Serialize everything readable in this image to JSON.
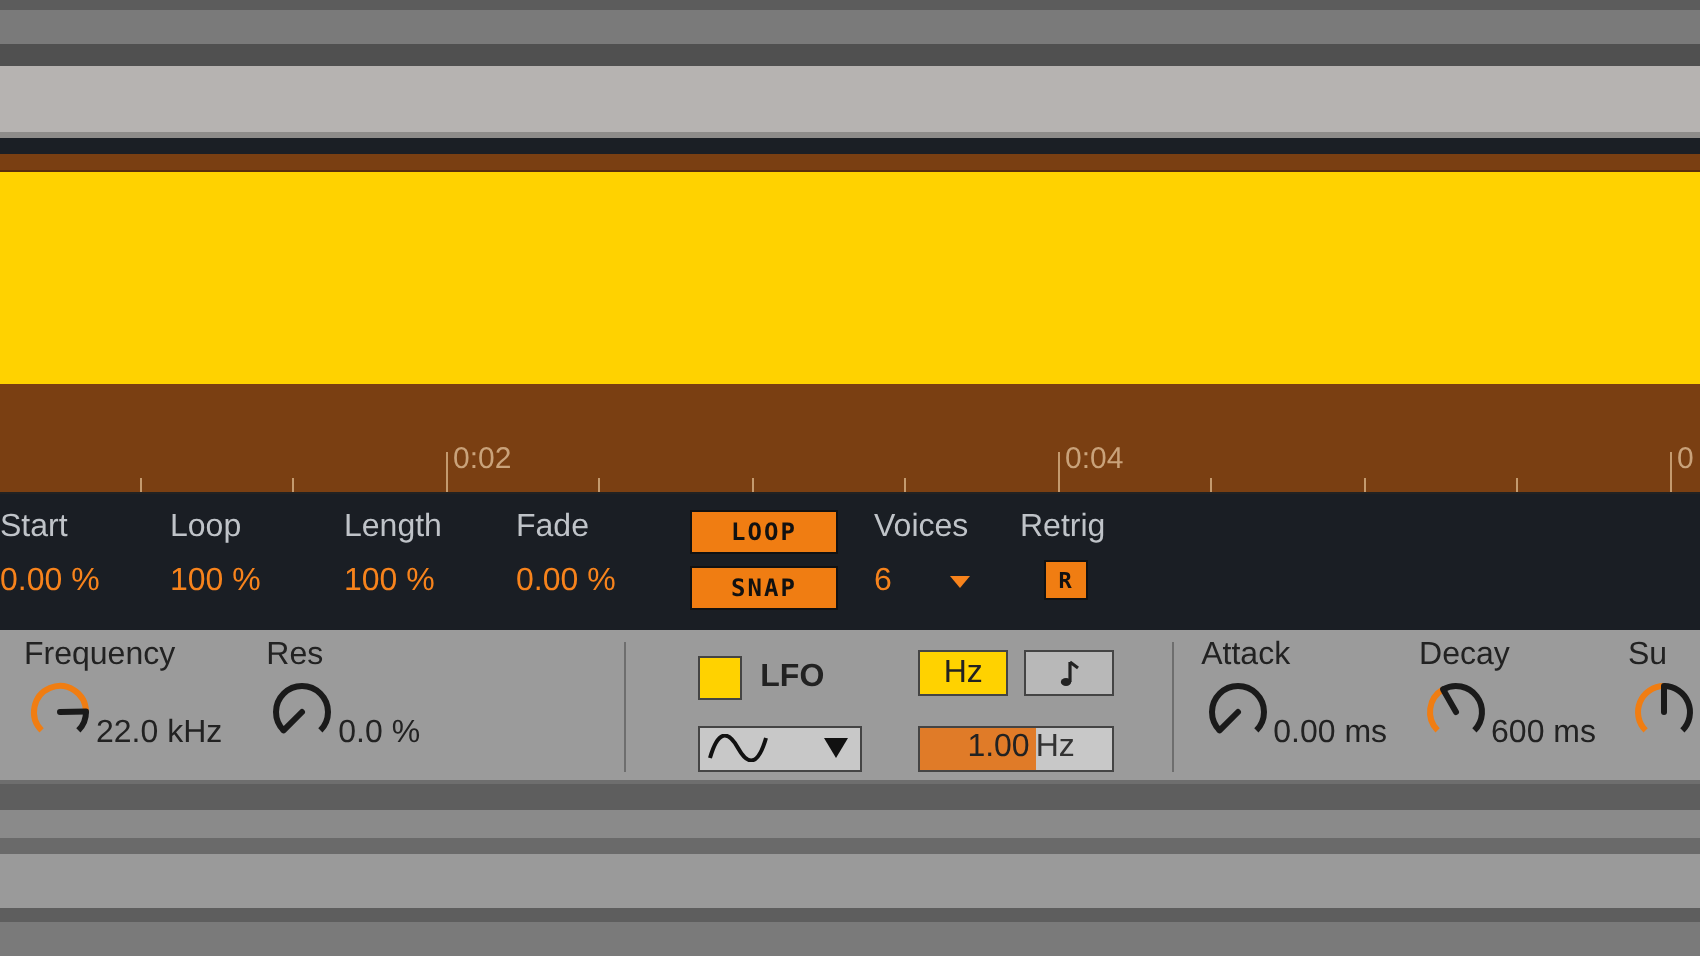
{
  "ruler": {
    "labels": [
      "0:02",
      "0:04",
      "0"
    ]
  },
  "sample": {
    "params": [
      {
        "label": "Start",
        "value": "0.00 %"
      },
      {
        "label": "Loop",
        "value": "100 %"
      },
      {
        "label": "Length",
        "value": "100 %"
      },
      {
        "label": "Fade",
        "value": "0.00 %"
      }
    ],
    "loop": {
      "label": "LOOP",
      "on": true
    },
    "snap": {
      "label": "SNAP",
      "on": true
    },
    "voices": {
      "label": "Voices",
      "value": "6"
    },
    "retrig": {
      "label": "Retrig",
      "button": "R",
      "on": true
    }
  },
  "filter": {
    "knobs": [
      {
        "label": "Frequency",
        "value": "22.0 kHz"
      },
      {
        "label": "Res",
        "value": "0.0 %"
      }
    ]
  },
  "lfo": {
    "label": "LFO",
    "checked": true,
    "rate_modes": [
      {
        "kind": "hz",
        "label": "Hz",
        "selected": true
      },
      {
        "kind": "note",
        "selected": false
      }
    ],
    "rate": {
      "value": "1.00",
      "unit": "Hz",
      "level": 0.6
    }
  },
  "envelope": {
    "knobs": [
      {
        "label": "Attack",
        "value": "0.00 ms"
      },
      {
        "label": "Decay",
        "value": "600 ms"
      },
      {
        "label": "Su"
      }
    ]
  }
}
